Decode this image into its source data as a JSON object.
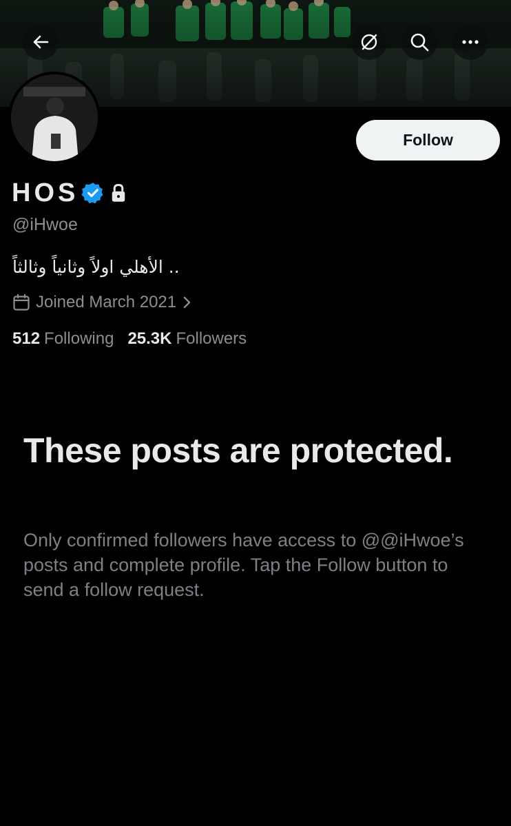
{
  "colors": {
    "background": "#000000",
    "primary_text": "#e7e9ea",
    "secondary_text": "#8b8f93",
    "verified_blue": "#1d9bf0",
    "follow_button_bg": "#eff3f4",
    "follow_button_text": "#0f1419",
    "banner_green": "#1f8a46"
  },
  "header": {
    "back_icon": "arrow-left-icon",
    "actions": [
      {
        "name": "grok-icon"
      },
      {
        "name": "search-icon"
      },
      {
        "name": "more-icon"
      }
    ]
  },
  "profile": {
    "display_name": "HOS",
    "verified": true,
    "protected": true,
    "handle": "@iHwoe",
    "bio": "الأهلي اولاً وثانياً وثالثاً ..",
    "joined": "Joined March 2021",
    "following_count": "512",
    "following_label": "Following",
    "followers_count": "25.3K",
    "followers_label": "Followers"
  },
  "follow_button": {
    "label": "Follow"
  },
  "protected_notice": {
    "title": "These posts are protected.",
    "body": "Only confirmed followers have access to @@iHwoe’s posts and complete profile. Tap the Follow button to send a follow request."
  }
}
